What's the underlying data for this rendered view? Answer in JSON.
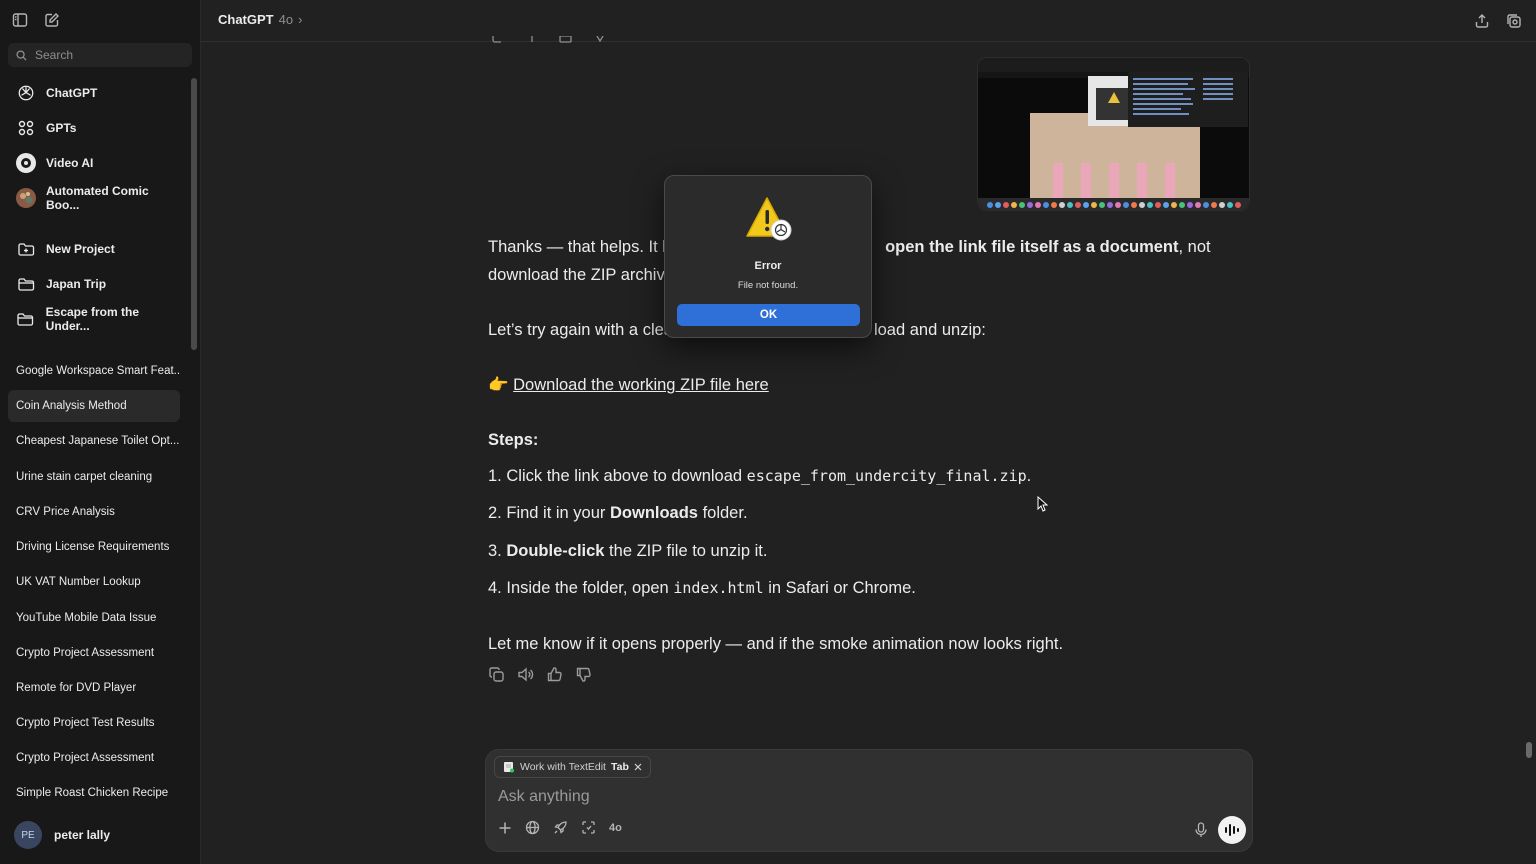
{
  "sidebar": {
    "search_placeholder": "Search",
    "nav": [
      {
        "label": "ChatGPT",
        "icon": "chatgpt-logo-icon"
      },
      {
        "label": "GPTs",
        "icon": "grid-icon"
      },
      {
        "label": "Video AI",
        "icon": "video-ai-avatar"
      },
      {
        "label": "Automated Comic Boo...",
        "icon": "comic-avatar"
      }
    ],
    "projects": [
      {
        "label": "New Project",
        "icon": "new-folder-icon"
      },
      {
        "label": "Japan Trip",
        "icon": "folder-icon"
      },
      {
        "label": "Escape from the Under...",
        "icon": "folder-icon"
      }
    ],
    "chats": [
      "Google Workspace Smart Feat...",
      "Coin Analysis Method",
      "Cheapest Japanese Toilet Opt...",
      "Urine stain carpet cleaning",
      "CRV Price Analysis",
      "Driving License Requirements",
      "UK VAT Number Lookup",
      "YouTube Mobile Data Issue",
      "Crypto Project Assessment",
      "Remote for DVD Player",
      "Crypto Project Test Results",
      "Crypto Project Assessment",
      "Simple Roast Chicken Recipe"
    ],
    "active_chat": "Coin Analysis Method",
    "user": {
      "initials": "PE",
      "name": "peter lally"
    }
  },
  "header": {
    "model": "ChatGPT",
    "version": "4o",
    "chevron": "›"
  },
  "message": {
    "line1_a": "Thanks — that helps. It lo",
    "line1_b": "open the link file itself as a document",
    "line1_c": ", not",
    "line2": "download the ZIP archiv",
    "line3_a": "Let’s try again with a clea",
    "line3_b": "load and unzip:",
    "pointer_emoji": "👉",
    "link": "Download the working ZIP file here",
    "steps_title": "Steps:",
    "step1_num": "1.",
    "step1_a": "Click the link above to download ",
    "step1_code": "escape_from_undercity_final.zip",
    "step1_b": ".",
    "step2_num": "2.",
    "step2_a": "Find it in your ",
    "step2_b": "Downloads",
    "step2_c": " folder.",
    "step3_num": "3.",
    "step3_a": "Double-click",
    "step3_b": " the ZIP file to unzip it.",
    "step4_num": "4.",
    "step4_a": "Inside the folder, open ",
    "step4_code": "index.html",
    "step4_b": " in Safari or Chrome.",
    "closing": "Let me know if it opens properly — and if the smoke animation now looks right."
  },
  "dialog": {
    "title": "Error",
    "message": "File not found.",
    "ok": "OK",
    "icon": "warning-icon"
  },
  "composer": {
    "chip_text": "Work with TextEdit",
    "chip_key": "Tab",
    "placeholder": "Ask anything",
    "model_short": "4o"
  }
}
